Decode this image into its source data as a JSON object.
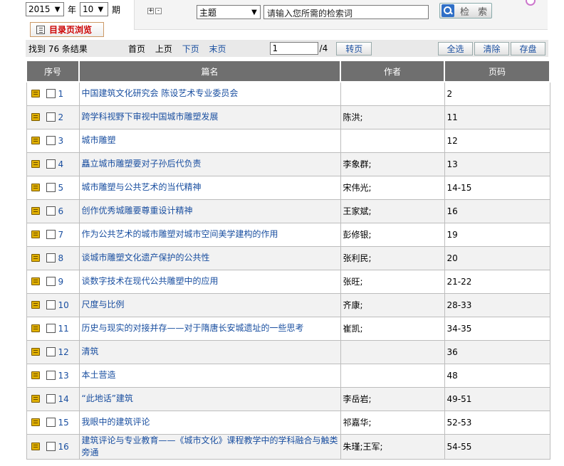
{
  "date": {
    "year": "2015",
    "year_unit": "年",
    "issue": "10",
    "issue_unit": "期",
    "toc_label": "目录页浏览"
  },
  "search": {
    "expand_label": "+",
    "collapse_label": "-",
    "field": "主题",
    "placeholder": "请输入您所需的检索词",
    "button_label": "检 索"
  },
  "toolbar": {
    "result_count": "找到 76 条结果",
    "first": "首页",
    "prev": "上页",
    "next": "下页",
    "last": "末页",
    "page_value": "1",
    "page_total": "/4",
    "goto_label": "转页",
    "select_all": "全选",
    "clear": "清除",
    "save": "存盘"
  },
  "table": {
    "headers": [
      "序号",
      "篇名",
      "作者",
      "页码"
    ],
    "rows": [
      {
        "no": "1",
        "title": "中国建筑文化研究会 陈设艺术专业委员会",
        "author": "",
        "pages": "2"
      },
      {
        "no": "2",
        "title": "跨学科视野下审视中国城市雕塑发展",
        "author": "陈洪;",
        "pages": "11"
      },
      {
        "no": "3",
        "title": "城市雕塑",
        "author": "",
        "pages": "12"
      },
      {
        "no": "4",
        "title": "矗立城市雕塑要对子孙后代负责",
        "author": "李象群;",
        "pages": "13"
      },
      {
        "no": "5",
        "title": "城市雕塑与公共艺术的当代精神",
        "author": "宋伟光;",
        "pages": "14-15"
      },
      {
        "no": "6",
        "title": "创作优秀城雕要尊重设计精神",
        "author": "王家斌;",
        "pages": "16"
      },
      {
        "no": "7",
        "title": "作为公共艺术的城市雕塑对城市空间美学建构的作用",
        "author": "彭修银;",
        "pages": "19"
      },
      {
        "no": "8",
        "title": "谈城市雕塑文化遗产保护的公共性",
        "author": "张利民;",
        "pages": "20"
      },
      {
        "no": "9",
        "title": "谈数字技术在现代公共雕塑中的应用",
        "author": "张旺;",
        "pages": "21-22"
      },
      {
        "no": "10",
        "title": "尺度与比例",
        "author": "齐康;",
        "pages": "28-33"
      },
      {
        "no": "11",
        "title": "历史与现实的对接并存——对于隋唐长安城遗址的一些思考",
        "author": "崔凯;",
        "pages": "34-35"
      },
      {
        "no": "12",
        "title": "清筑",
        "author": "",
        "pages": "36"
      },
      {
        "no": "13",
        "title": "本土营造",
        "author": "",
        "pages": "48"
      },
      {
        "no": "14",
        "title": "“此地话”建筑",
        "author": "李岳岩;",
        "pages": "49-51"
      },
      {
        "no": "15",
        "title": "我眼中的建筑评论",
        "author": "祁嘉华;",
        "pages": "52-53"
      },
      {
        "no": "16",
        "title": "建筑评论与专业教育——《城市文化》课程教学中的学科融合与触类旁通",
        "author": "朱瑾;王军;",
        "pages": "54-55"
      }
    ]
  }
}
